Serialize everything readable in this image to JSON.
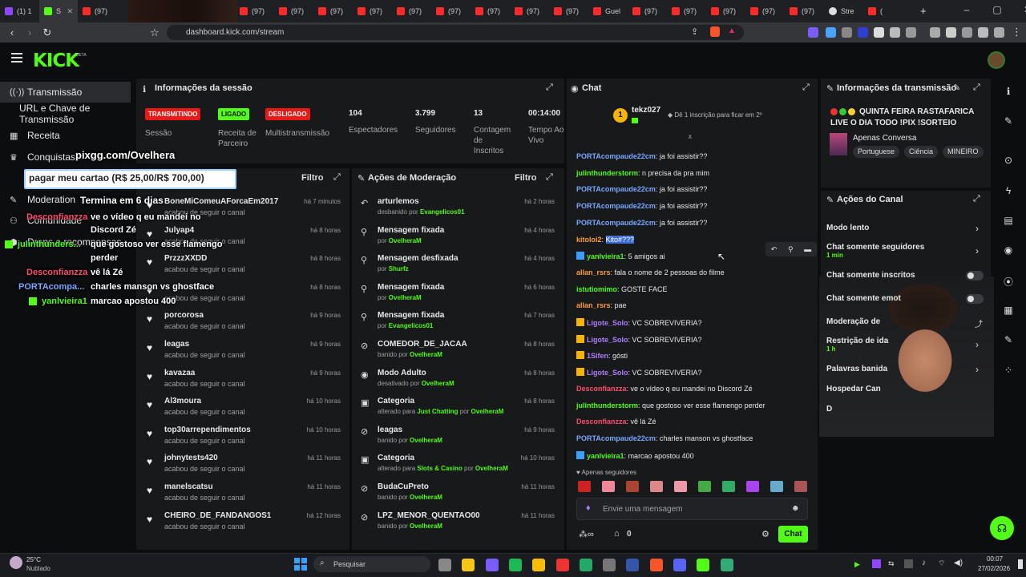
{
  "browser": {
    "tabs": [
      {
        "label": "(1) 1",
        "fav": "twitch"
      },
      {
        "label": "S",
        "fav": "kick",
        "active": true
      },
      {
        "label": "(97)",
        "fav": "yt"
      },
      {
        "label": "",
        "fav": "none"
      },
      {
        "label": "(97)",
        "fav": "yt"
      },
      {
        "label": "(97)",
        "fav": "yt"
      },
      {
        "label": "(97)",
        "fav": "yt"
      },
      {
        "label": "(97)",
        "fav": "yt"
      },
      {
        "label": "(97)",
        "fav": "yt"
      },
      {
        "label": "(97)",
        "fav": "yt"
      },
      {
        "label": "(97)",
        "fav": "yt"
      },
      {
        "label": "(97)",
        "fav": "yt"
      },
      {
        "label": "(97)",
        "fav": "yt"
      },
      {
        "label": "(97)",
        "fav": "yt"
      },
      {
        "label": "(97)",
        "fav": "yt"
      },
      {
        "label": "Guel",
        "fav": "yt"
      },
      {
        "label": "(97)",
        "fav": "yt"
      },
      {
        "label": "(97)",
        "fav": "yt"
      },
      {
        "label": "(97)",
        "fav": "yt"
      },
      {
        "label": "(97)",
        "fav": "yt"
      },
      {
        "label": "(97)",
        "fav": "yt"
      },
      {
        "label": "Stre",
        "fav": "gh"
      },
      {
        "label": "(",
        "fav": "yt"
      }
    ],
    "url": "dashboard.kick.com/stream"
  },
  "sidebar": {
    "transmissao": "Transmissão",
    "url_chave": "URL e Chave de Transmissão",
    "receita": "Receita",
    "conquistas": "Conquistas",
    "moderation": "Moderation",
    "comunidade": "Comunidade",
    "drops": "Drops e recompensas"
  },
  "overlay": {
    "pixgg": "pixgg.com/Ovelhera",
    "meta": "pagar meu cartao (R$ 25,00/R$ 700,00)",
    "termina": "Termina em 6 dias",
    "chat": [
      {
        "user": "Desconfianzza",
        "msg": "ve o vídeo q eu mandei no"
      },
      {
        "user": "",
        "msg": "Discord Zé"
      },
      {
        "user": "julinthunders...",
        "msg": "que gostoso ver esse flamengo"
      },
      {
        "user": "",
        "msg": "perder"
      },
      {
        "user": "Desconfianzza",
        "msg": "vê lá Zé"
      },
      {
        "user": "PORTAcompa...",
        "msg": "charles manson vs ghostface"
      },
      {
        "user": "yanlvieira1",
        "msg": "marcao apostou 400"
      }
    ]
  },
  "session": {
    "title": "Informações da sessão",
    "badges": {
      "transmitindo": "TRANSMITINDO",
      "ligado": "LIGADO",
      "desligado": "DESLIGADO"
    },
    "labels": {
      "sessao": "Sessão",
      "receita": "Receita de Parceiro",
      "multi": "Multistransmissão"
    },
    "stats": [
      {
        "value": "104",
        "label": "Espectadores"
      },
      {
        "value": "3.799",
        "label": "Seguidores"
      },
      {
        "value": "13",
        "label": "Contagem de Inscritos"
      },
      {
        "value": "00:14:00",
        "label": "Tempo Ao Vivo"
      }
    ]
  },
  "followers": {
    "filter": "Filtro",
    "items": [
      {
        "name": "BoneMiComeuAForcaEm2017",
        "sub": "acabou de seguir o canal",
        "time": "há 7 minutos"
      },
      {
        "name": "Julyap4",
        "sub": "acabou de seguir o canal",
        "time": "há 8 horas"
      },
      {
        "name": "PrzzzXXDD",
        "sub": "acabou de seguir o canal",
        "time": "há 8 horas"
      },
      {
        "name": "",
        "sub": "acabou de seguir o canal",
        "time": "há 8 horas"
      },
      {
        "name": "porcorosa",
        "sub": "acabou de seguir o canal",
        "time": "há 9 horas"
      },
      {
        "name": "leagas",
        "sub": "acabou de seguir o canal",
        "time": "há 9 horas"
      },
      {
        "name": "kavazaa",
        "sub": "acabou de seguir o canal",
        "time": "há 9 horas"
      },
      {
        "name": "Al3moura",
        "sub": "acabou de seguir o canal",
        "time": "há 10 horas"
      },
      {
        "name": "top30arrependimentos",
        "sub": "acabou de seguir o canal",
        "time": "há 10 horas"
      },
      {
        "name": "johnytests420",
        "sub": "acabou de seguir o canal",
        "time": "há 11 horas"
      },
      {
        "name": "manelscatsu",
        "sub": "acabou de seguir o canal",
        "time": "há 11 horas"
      },
      {
        "name": "CHEIRO_DE_FANDANGOS1",
        "sub": "acabou de seguir o canal",
        "time": "há 12 horas"
      }
    ]
  },
  "moderation": {
    "title": "Ações de Moderação",
    "filter": "Filtro",
    "items": [
      {
        "icon": "↶",
        "name": "arturlemos",
        "sub": "desbanido por ",
        "by": "Evangelicos01",
        "time": "há 2 horas"
      },
      {
        "icon": "⚲",
        "name": "Mensagem fixada",
        "sub": "por ",
        "by": "OvelheraM",
        "time": "há 4 horas"
      },
      {
        "icon": "⚲",
        "name": "Mensagem desfixada",
        "sub": "por ",
        "by": "Shurfz",
        "time": "há 4 horas"
      },
      {
        "icon": "⚲",
        "name": "Mensagem fixada",
        "sub": "por ",
        "by": "OvelheraM",
        "time": "há 6 horas"
      },
      {
        "icon": "⚲",
        "name": "Mensagem fixada",
        "sub": "por ",
        "by": "Evangelicos01",
        "time": "há 7 horas"
      },
      {
        "icon": "⊘",
        "name": "COMEDOR_DE_JACAA",
        "sub": "banido por ",
        "by": "OvelheraM",
        "time": "há 8 horas"
      },
      {
        "icon": "◉",
        "name": "Modo Adulto",
        "sub": "desativado por ",
        "by": "OvelheraM",
        "time": "há 8 horas"
      },
      {
        "icon": "▣",
        "name": "Categoria",
        "sub": "alterado para ",
        "cat": "Just Chatting",
        "by": "OvelheraM",
        "time": "há 8 horas"
      },
      {
        "icon": "⊘",
        "name": "leagas",
        "sub": "banido por ",
        "by": "OvelheraM",
        "time": "há 9 horas"
      },
      {
        "icon": "▣",
        "name": "Categoria",
        "sub": "alterado para ",
        "cat": "Slots & Casino",
        "by": "OvelheraM",
        "time": "há 10 horas"
      },
      {
        "icon": "⊘",
        "name": "BudaCuPreto",
        "sub": "banido por ",
        "by": "OvelheraM",
        "time": "há 11 horas"
      },
      {
        "icon": "⊘",
        "name": "LPZ_MENOR_QUENTAO00",
        "sub": "banido por ",
        "by": "OvelheraM",
        "time": "há 11 horas"
      }
    ]
  },
  "chat": {
    "title": "Chat",
    "pinned_user": "tekz027",
    "pinned_rank": "1",
    "pinned_note": "Dê 1 inscrição para ficar em 2º",
    "messages": [
      {
        "user": "PORTAcompaude22cm",
        "color": "blue",
        "msg": "ja foi assistir??"
      },
      {
        "user": "julinthunderstorm",
        "color": "green",
        "msg": "n precisa da pra mim"
      },
      {
        "user": "PORTAcompaude22cm",
        "color": "blue",
        "msg": "ja foi assistir??"
      },
      {
        "user": "PORTAcompaude22cm",
        "color": "blue",
        "msg": "ja foi assistir??"
      },
      {
        "user": "PORTAcompaude22cm",
        "color": "blue",
        "msg": "ja foi assistir??"
      },
      {
        "user": "kitoloi2",
        "color": "orange",
        "msg": "Kito#???",
        "highlight": true
      },
      {
        "user": "yanlvieira1",
        "color": "green",
        "msg": "5 amigos ai"
      },
      {
        "user": "allan_rsrs",
        "color": "orange",
        "msg": "fala o nome de 2 pessoas do filme"
      },
      {
        "user": "istutiomimo",
        "color": "green",
        "msg": "GOSTE FACE"
      },
      {
        "user": "allan_rsrs",
        "color": "orange",
        "msg": "pae"
      },
      {
        "user": "Ligote_Solo",
        "color": "purple",
        "msg": "VC SOBREVIVERIA?"
      },
      {
        "user": "Ligote_Solo",
        "color": "purple",
        "msg": "VC SOBREVIVERIA?"
      },
      {
        "user": "1Sifen",
        "color": "purple",
        "msg": "gósti"
      },
      {
        "user": "Ligote_Solo",
        "color": "purple",
        "msg": "VC SOBREVIVERIA?"
      },
      {
        "user": "Desconfianzza",
        "color": "red",
        "msg": "ve o vídeo q eu mandei no Discord Zé"
      },
      {
        "user": "julinthunderstorm",
        "color": "green",
        "msg": "que gostoso ver esse flamengo perder"
      },
      {
        "user": "Desconfianzza",
        "color": "red",
        "msg": "vê lá Zé"
      },
      {
        "user": "PORTAcompaude22cm",
        "color": "blue",
        "msg": "charles manson vs ghostface"
      },
      {
        "user": "yanlvieira1",
        "color": "green",
        "msg": "marcao apostou 400"
      }
    ],
    "followers_only": "Apenas seguidores",
    "placeholder": "Envie uma mensagem",
    "points": "0",
    "send": "Chat"
  },
  "stream_info": {
    "title": "Informações da transmissão",
    "stream_title": "QUINTA FEIRA RASTAFARICA LIVE O DIA TODO !PIX !SORTEIO",
    "category": "Apenas Conversa",
    "tags": [
      "Portuguese",
      "Ciência",
      "MINEIRO"
    ]
  },
  "channel_actions": {
    "title": "Ações do Canal",
    "items": [
      {
        "label": "Modo lento",
        "sub": "",
        "type": "chevron"
      },
      {
        "label": "Chat somente seguidores",
        "sub": "1 min",
        "type": "chevron"
      },
      {
        "label": "Chat somente inscritos",
        "sub": "",
        "type": "toggle"
      },
      {
        "label": "Chat somente emot",
        "sub": "",
        "type": "toggle"
      },
      {
        "label": "Moderação de",
        "sub": "",
        "type": "link"
      },
      {
        "label": "Restrição de ida",
        "sub": "1 h",
        "type": "chevron"
      },
      {
        "label": "Palavras banida",
        "sub": "",
        "type": "chevron"
      },
      {
        "label": "Hospedar Can",
        "sub": "",
        "type": "none"
      },
      {
        "label": "D",
        "sub": "",
        "type": "none"
      }
    ]
  },
  "taskbar": {
    "weather_temp": "25°C",
    "weather_desc": "Nublado",
    "search": "Pesquisar",
    "time": "00:07",
    "date": "27/02/2026"
  }
}
